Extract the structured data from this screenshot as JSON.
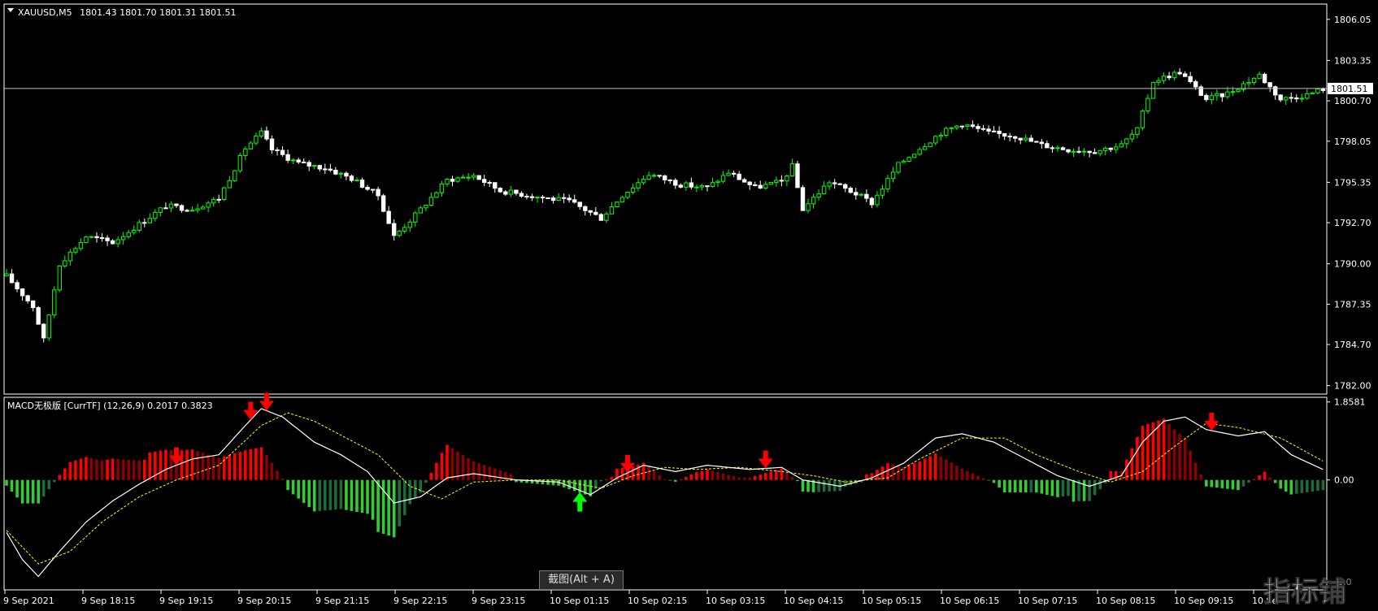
{
  "main_chart": {
    "symbol_title": "XAUUSD,M5",
    "ohlc_text": "1801.43 1801.70 1801.31 1801.51",
    "current_price_label": "1801.51",
    "current_price": 1801.51,
    "price_ticks": [
      "1806.05",
      "1803.35",
      "1800.70",
      "1798.05",
      "1795.35",
      "1792.70",
      "1790.00",
      "1787.35",
      "1784.70",
      "1782.00"
    ],
    "price_tick_values": [
      1806.05,
      1803.35,
      1800.7,
      1798.05,
      1795.35,
      1792.7,
      1790.0,
      1787.35,
      1784.7,
      1782.0
    ],
    "colors": {
      "bull": "#00ff00",
      "bear": "#ffffff",
      "grid_line": "#c0c0c0",
      "axis": "#ffffff",
      "background": "#000000"
    }
  },
  "indicator": {
    "title": "MACD无极版 [CurrTF] (12,26,9) 0.2017 0.3823",
    "ticks": [
      "1.8581",
      "0.00"
    ],
    "tick_values": [
      1.8581,
      0.0
    ],
    "partial_tick": "-2.0",
    "colors": {
      "pos_strong": "#ff0000",
      "pos_weak": "#8b0000",
      "neg_strong": "#32cd32",
      "neg_weak": "#1e6b3a",
      "macd_line": "#ffffff",
      "signal_line": "#ffff00",
      "sell_arrow": "#ff0000",
      "buy_arrow": "#00ff00"
    }
  },
  "time_axis": {
    "labels": [
      "9 Sep 2021",
      "9 Sep 18:15",
      "9 Sep 19:15",
      "9 Sep 20:15",
      "9 Sep 21:15",
      "9 Sep 22:15",
      "9 Sep 23:15",
      "10 Sep 01:15",
      "10 Sep 02:15",
      "10 Sep 03:15",
      "10 Sep 04:15",
      "10 Sep 05:15",
      "10 Sep 06:15",
      "10 Sep 07:15",
      "10 Sep 08:15",
      "10 Sep 09:15",
      "10 Se"
    ]
  },
  "tooltip": {
    "text": "截图(Alt + A)"
  },
  "watermark": {
    "text": "指标铺"
  },
  "chart_data": [
    {
      "type": "candlestick",
      "title": "XAUUSD,M5",
      "ylim": [
        1781.5,
        1807.0
      ],
      "close_keypoints": [
        [
          0,
          1789.2
        ],
        [
          5,
          1787.2
        ],
        [
          7,
          1785.0
        ],
        [
          10,
          1790.0
        ],
        [
          15,
          1791.8
        ],
        [
          20,
          1791.4
        ],
        [
          25,
          1792.6
        ],
        [
          30,
          1793.8
        ],
        [
          35,
          1793.6
        ],
        [
          40,
          1794.3
        ],
        [
          45,
          1797.6
        ],
        [
          48,
          1798.6
        ],
        [
          50,
          1797.5
        ],
        [
          55,
          1796.6
        ],
        [
          60,
          1796.3
        ],
        [
          65,
          1795.6
        ],
        [
          70,
          1794.5
        ],
        [
          73,
          1791.8
        ],
        [
          77,
          1793.2
        ],
        [
          83,
          1795.5
        ],
        [
          88,
          1795.8
        ],
        [
          93,
          1794.8
        ],
        [
          100,
          1794.4
        ],
        [
          106,
          1794.1
        ],
        [
          112,
          1793.0
        ],
        [
          116,
          1794.5
        ],
        [
          121,
          1795.9
        ],
        [
          127,
          1795.2
        ],
        [
          132,
          1795.0
        ],
        [
          136,
          1796.0
        ],
        [
          141,
          1795.0
        ],
        [
          146,
          1795.4
        ],
        [
          148,
          1796.4
        ],
        [
          150,
          1793.6
        ],
        [
          155,
          1795.4
        ],
        [
          160,
          1794.6
        ],
        [
          163,
          1794.0
        ],
        [
          168,
          1796.5
        ],
        [
          172,
          1797.6
        ],
        [
          176,
          1798.6
        ],
        [
          180,
          1799.2
        ],
        [
          185,
          1798.6
        ],
        [
          190,
          1798.4
        ],
        [
          195,
          1797.8
        ],
        [
          200,
          1797.5
        ],
        [
          205,
          1797.4
        ],
        [
          210,
          1797.8
        ],
        [
          213,
          1798.8
        ],
        [
          216,
          1802.0
        ],
        [
          221,
          1802.6
        ],
        [
          226,
          1800.8
        ],
        [
          230,
          1801.2
        ],
        [
          236,
          1802.4
        ],
        [
          240,
          1800.8
        ],
        [
          245,
          1801.1
        ],
        [
          248,
          1801.5
        ]
      ]
    },
    {
      "type": "macd",
      "title": "MACD无极版 [CurrTF] (12,26,9) 0.2017 0.3823",
      "ylim": [
        -2.6,
        1.95
      ],
      "macd_keypoints": [
        [
          0,
          -1.25
        ],
        [
          3,
          -1.9
        ],
        [
          6,
          -2.3
        ],
        [
          10,
          -1.7
        ],
        [
          15,
          -1.0
        ],
        [
          20,
          -0.5
        ],
        [
          25,
          -0.1
        ],
        [
          30,
          0.25
        ],
        [
          35,
          0.5
        ],
        [
          40,
          0.6
        ],
        [
          45,
          1.3
        ],
        [
          48,
          1.7
        ],
        [
          52,
          1.5
        ],
        [
          58,
          0.9
        ],
        [
          63,
          0.6
        ],
        [
          68,
          0.2
        ],
        [
          73,
          -0.55
        ],
        [
          78,
          -0.4
        ],
        [
          83,
          0.05
        ],
        [
          88,
          0.15
        ],
        [
          96,
          0.0
        ],
        [
          104,
          -0.05
        ],
        [
          110,
          -0.35
        ],
        [
          115,
          0.05
        ],
        [
          120,
          0.35
        ],
        [
          126,
          0.2
        ],
        [
          132,
          0.35
        ],
        [
          140,
          0.25
        ],
        [
          146,
          0.3
        ],
        [
          150,
          0.0
        ],
        [
          157,
          -0.15
        ],
        [
          163,
          0.05
        ],
        [
          169,
          0.4
        ],
        [
          175,
          1.0
        ],
        [
          180,
          1.1
        ],
        [
          186,
          0.9
        ],
        [
          192,
          0.5
        ],
        [
          198,
          0.1
        ],
        [
          204,
          -0.15
        ],
        [
          210,
          0.1
        ],
        [
          214,
          0.9
        ],
        [
          218,
          1.4
        ],
        [
          222,
          1.5
        ],
        [
          226,
          1.2
        ],
        [
          232,
          1.05
        ],
        [
          237,
          1.15
        ],
        [
          242,
          0.6
        ],
        [
          248,
          0.25
        ]
      ],
      "signal_keypoints": [
        [
          0,
          -1.2
        ],
        [
          6,
          -2.0
        ],
        [
          12,
          -1.7
        ],
        [
          18,
          -1.0
        ],
        [
          25,
          -0.4
        ],
        [
          32,
          0.0
        ],
        [
          40,
          0.35
        ],
        [
          48,
          1.3
        ],
        [
          53,
          1.6
        ],
        [
          58,
          1.4
        ],
        [
          64,
          1.0
        ],
        [
          70,
          0.6
        ],
        [
          76,
          -0.15
        ],
        [
          82,
          -0.45
        ],
        [
          88,
          -0.05
        ],
        [
          96,
          0.0
        ],
        [
          104,
          0.0
        ],
        [
          112,
          -0.2
        ],
        [
          118,
          0.1
        ],
        [
          124,
          0.3
        ],
        [
          130,
          0.25
        ],
        [
          138,
          0.3
        ],
        [
          146,
          0.2
        ],
        [
          152,
          0.1
        ],
        [
          158,
          -0.05
        ],
        [
          166,
          0.05
        ],
        [
          172,
          0.5
        ],
        [
          180,
          1.0
        ],
        [
          188,
          1.0
        ],
        [
          194,
          0.6
        ],
        [
          202,
          0.2
        ],
        [
          208,
          -0.05
        ],
        [
          214,
          0.2
        ],
        [
          220,
          0.8
        ],
        [
          226,
          1.35
        ],
        [
          232,
          1.25
        ],
        [
          240,
          1.0
        ],
        [
          248,
          0.45
        ]
      ],
      "sell_arrow_indices": [
        32,
        46,
        49,
        117,
        143,
        227
      ],
      "buy_arrow_indices": [
        108
      ]
    }
  ]
}
